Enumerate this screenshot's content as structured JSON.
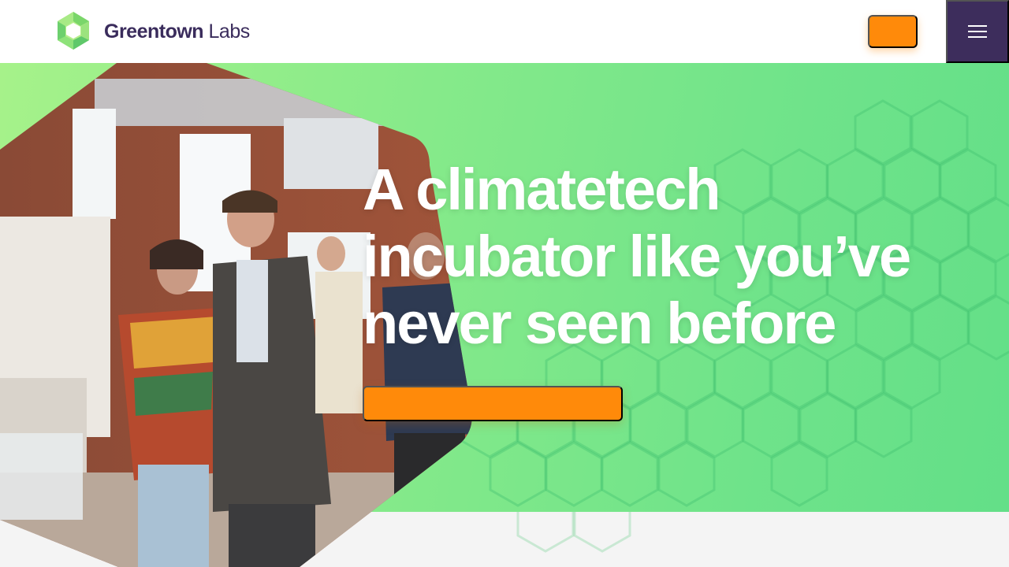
{
  "brand": {
    "name_bold": "Greentown",
    "name_light": " Labs",
    "logo_icon": "greentown-hexagon-logo"
  },
  "header": {
    "cta_label": "",
    "menu_icon": "hamburger-menu-icon"
  },
  "hero": {
    "title_line1": "A climatetech",
    "title_line2": "incubator like you’ve",
    "title_line3": "never seen before",
    "cta_label": "",
    "photo_icon": "event-photo"
  },
  "colors": {
    "accent_orange": "#ff8a0a",
    "brand_purple": "#3d2d5c",
    "hero_green": "#86ea8a",
    "page_bg": "#f4f4f4"
  }
}
